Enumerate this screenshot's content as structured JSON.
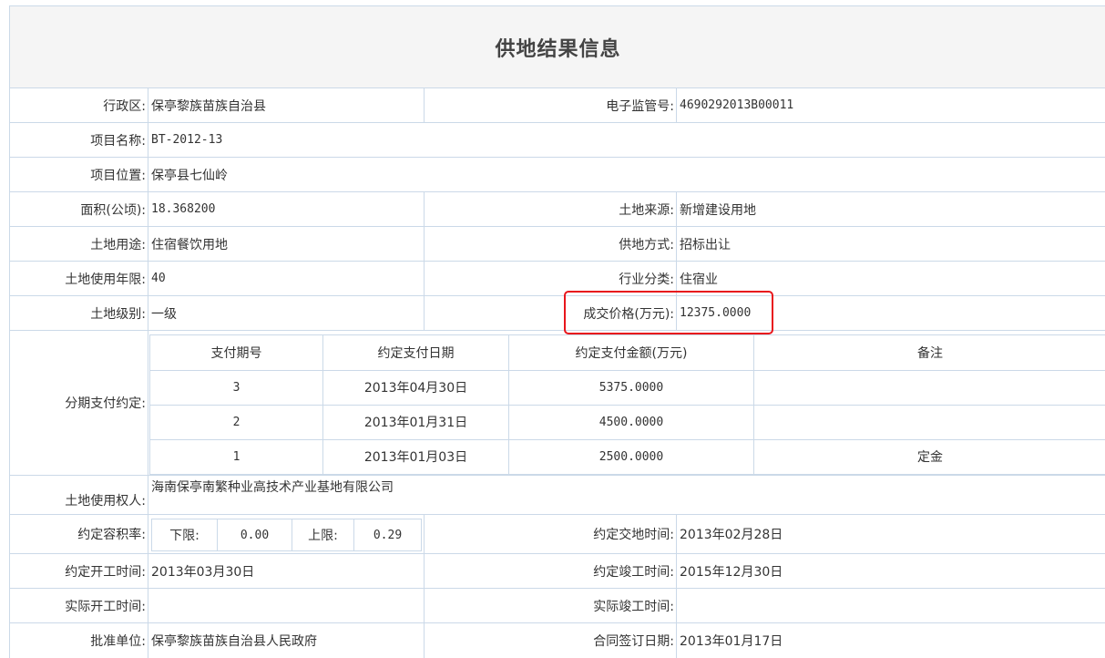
{
  "title": "供地结果信息",
  "fields": {
    "admin_region": {
      "label": "行政区:",
      "value": "保亭黎族苗族自治县"
    },
    "e_supervision_no": {
      "label": "电子监管号:",
      "value": "4690292013B00011"
    },
    "project_name": {
      "label": "项目名称:",
      "value": "BT-2012-13"
    },
    "project_location": {
      "label": "项目位置:",
      "value": "保亭县七仙岭"
    },
    "area": {
      "label": "面积(公顷):",
      "value": "18.368200"
    },
    "land_source": {
      "label": "土地来源:",
      "value": "新增建设用地"
    },
    "land_use": {
      "label": "土地用途:",
      "value": "住宿餐饮用地"
    },
    "supply_method": {
      "label": "供地方式:",
      "value": "招标出让"
    },
    "use_years": {
      "label": "土地使用年限:",
      "value": "40"
    },
    "industry": {
      "label": "行业分类:",
      "value": "住宿业"
    },
    "land_level": {
      "label": "土地级别:",
      "value": "一级"
    },
    "deal_price": {
      "label": "成交价格(万元):",
      "value": "12375.0000"
    },
    "installments_label": "分期支付约定:",
    "land_user": {
      "label": "土地使用权人:",
      "value": "海南保亭南繁种业高技术产业基地有限公司"
    },
    "far": {
      "label": "约定容积率:",
      "lower_label": "下限:",
      "lower_value": "0.00",
      "upper_label": "上限:",
      "upper_value": "0.29"
    },
    "handover_time": {
      "label": "约定交地时间:",
      "value": "2013年02月28日"
    },
    "planned_start": {
      "label": "约定开工时间:",
      "value": "2013年03月30日"
    },
    "planned_finish": {
      "label": "约定竣工时间:",
      "value": "2015年12月30日"
    },
    "actual_start": {
      "label": "实际开工时间:",
      "value": ""
    },
    "actual_finish": {
      "label": "实际竣工时间:",
      "value": ""
    },
    "approver": {
      "label": "批准单位:",
      "value": "保亭黎族苗族自治县人民政府"
    },
    "contract_date": {
      "label": "合同签订日期:",
      "value": "2013年01月17日"
    }
  },
  "installments": {
    "headers": [
      "支付期号",
      "约定支付日期",
      "约定支付金额(万元)",
      "备注"
    ],
    "rows": [
      [
        "3",
        "2013年04月30日",
        "5375.0000",
        ""
      ],
      [
        "2",
        "2013年01月31日",
        "4500.0000",
        ""
      ],
      [
        "1",
        "2013年01月03日",
        "2500.0000",
        "定金"
      ]
    ]
  },
  "highlight_color": "#e8161c",
  "border_color": "#cbd9e8"
}
